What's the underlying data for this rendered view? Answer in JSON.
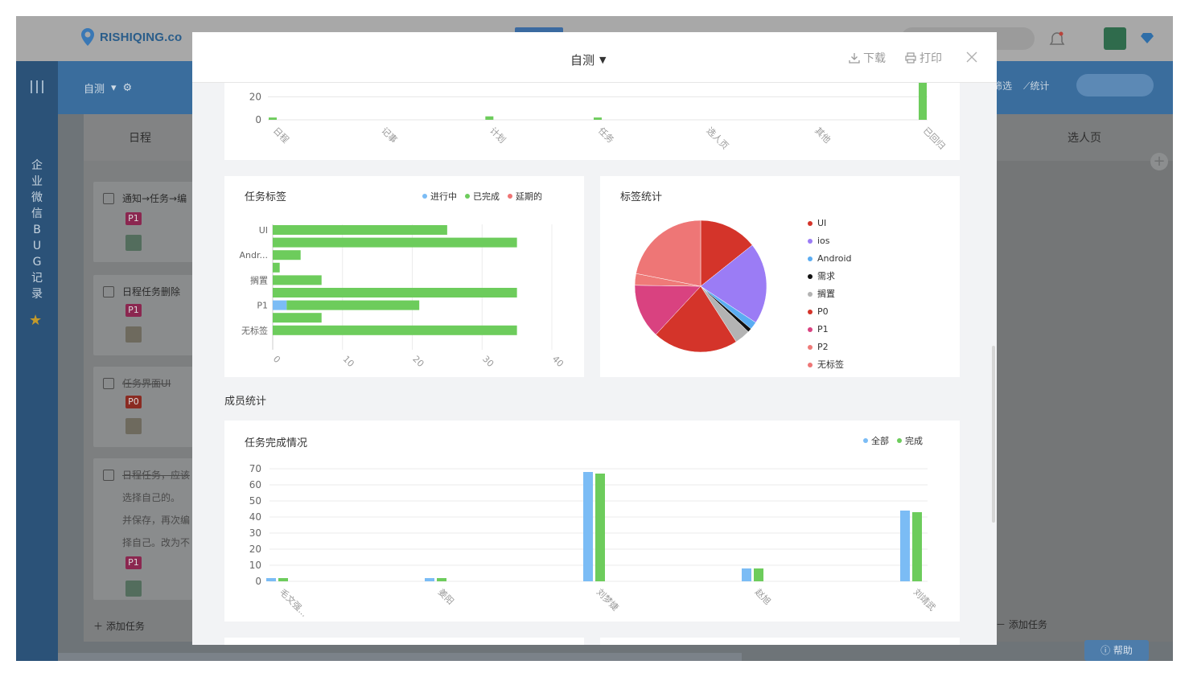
{
  "app": {
    "brand": "RISHIQING.co",
    "project_label": "自测",
    "side_title": [
      "企",
      "业",
      "微",
      "信",
      "B",
      "U",
      "G",
      "记",
      "录"
    ]
  },
  "toolbar": {
    "filter_label": "筛选",
    "stats_label": "统计"
  },
  "columns": {
    "left_head": "日程",
    "right_head": "选人页"
  },
  "cards": [
    {
      "title": "通知→任务→编",
      "tag": "P1",
      "done": false
    },
    {
      "title": "日程任务删除",
      "tag": "P1",
      "done": false
    },
    {
      "title": "任务界面UI",
      "tag": "P0",
      "done": true
    },
    {
      "title": "日程任务，应该",
      "tag": "P1",
      "done": true,
      "lines": [
        "选择自己的。",
        "并保存，再次编",
        "择自己。改为不"
      ]
    }
  ],
  "add_task_label": "添加任务",
  "help_label": "帮助",
  "modal": {
    "title": "自测",
    "download_label": "下载",
    "print_label": "打印"
  },
  "section_member_stats": "成员统计",
  "colors": {
    "blue": "#7bbcf5",
    "green": "#6dcc5c",
    "red": "#ef7474"
  },
  "chart_data": [
    {
      "type": "bar",
      "title": "",
      "categories": [
        "日程",
        "记事",
        "计划",
        "任务",
        "选人页",
        "其他",
        "已回归"
      ],
      "series": [
        {
          "values": [
            1,
            0,
            0,
            0,
            0,
            0,
            0
          ]
        },
        {
          "values": [
            2,
            0,
            3,
            2,
            0,
            0,
            35
          ]
        }
      ],
      "ylim": [
        0,
        35
      ],
      "yticks": [
        0,
        20
      ],
      "grid": true
    },
    {
      "type": "bar",
      "orientation": "horizontal",
      "title": "任务标签",
      "categories": [
        "UI",
        "",
        "Andr...",
        "",
        "搁置",
        "",
        "P1",
        "",
        "无标签",
        ""
      ],
      "series": [
        {
          "name": "进行中",
          "values": [
            0,
            0,
            0,
            0,
            0,
            0,
            2,
            0,
            0,
            0
          ]
        },
        {
          "name": "已完成",
          "values": [
            25,
            35,
            4,
            1,
            7,
            35,
            19,
            7,
            35,
            0
          ]
        },
        {
          "name": "延期的",
          "values": [
            0,
            0,
            0,
            0,
            0,
            0,
            0,
            0,
            0,
            0
          ]
        }
      ],
      "xlim": [
        0,
        40
      ],
      "xticks": [
        0,
        10,
        20,
        30,
        40
      ],
      "legend": "top-right"
    },
    {
      "type": "pie",
      "title": "标签统计",
      "labels": [
        "UI",
        "ios",
        "Android",
        "需求",
        "搁置",
        "P0",
        "P1",
        "P2",
        "无标签"
      ],
      "values": [
        15,
        21,
        2,
        1,
        4,
        22,
        14,
        3,
        23
      ],
      "colors": [
        "#d4342a",
        "#9b7cf5",
        "#5aacf2",
        "#111111",
        "#b3b3b3",
        "#d4342a",
        "#d94280",
        "#ef7a78",
        "#ee7676"
      ],
      "legend": "right"
    },
    {
      "type": "bar",
      "title": "任务完成情况",
      "categories": [
        "毛文强...",
        "姜阳",
        "刘梦婕",
        "赵旭",
        "刘靖武"
      ],
      "series": [
        {
          "name": "全部",
          "values": [
            2,
            2,
            68,
            8,
            44
          ]
        },
        {
          "name": "完成",
          "values": [
            2,
            2,
            67,
            8,
            43
          ]
        }
      ],
      "ylim": [
        0,
        70
      ],
      "yticks": [
        0,
        10,
        20,
        30,
        40,
        50,
        60,
        70
      ],
      "legend": "top-right",
      "grid": true
    }
  ]
}
